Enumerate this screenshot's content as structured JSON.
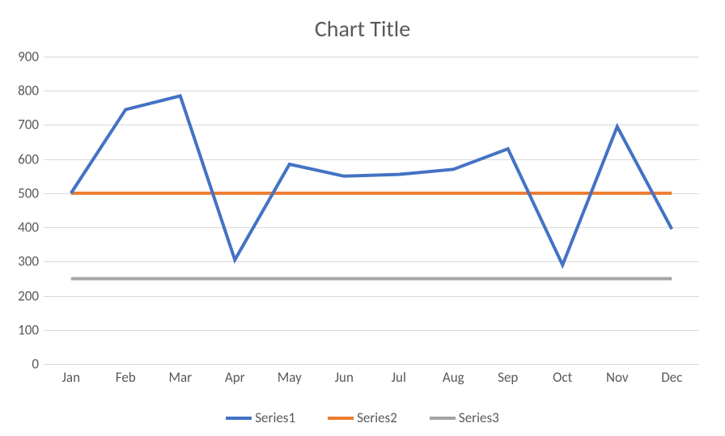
{
  "chart_data": {
    "type": "line",
    "title": "Chart Title",
    "xlabel": "",
    "ylabel": "",
    "categories": [
      "Jan",
      "Feb",
      "Mar",
      "Apr",
      "May",
      "Jun",
      "Jul",
      "Aug",
      "Sep",
      "Oct",
      "Nov",
      "Dec"
    ],
    "series": [
      {
        "name": "Series1",
        "color": "#4472C4",
        "values": [
          500,
          745,
          785,
          305,
          585,
          550,
          555,
          570,
          630,
          290,
          695,
          395
        ]
      },
      {
        "name": "Series2",
        "color": "#ED7D31",
        "values": [
          500,
          500,
          500,
          500,
          500,
          500,
          500,
          500,
          500,
          500,
          500,
          500
        ]
      },
      {
        "name": "Series3",
        "color": "#A5A5A5",
        "values": [
          250,
          250,
          250,
          250,
          250,
          250,
          250,
          250,
          250,
          250,
          250,
          250
        ]
      }
    ],
    "ylim": [
      0,
      900
    ],
    "y_ticks": [
      0,
      100,
      200,
      300,
      400,
      500,
      600,
      700,
      800,
      900
    ],
    "grid": true,
    "legend_position": "bottom"
  }
}
